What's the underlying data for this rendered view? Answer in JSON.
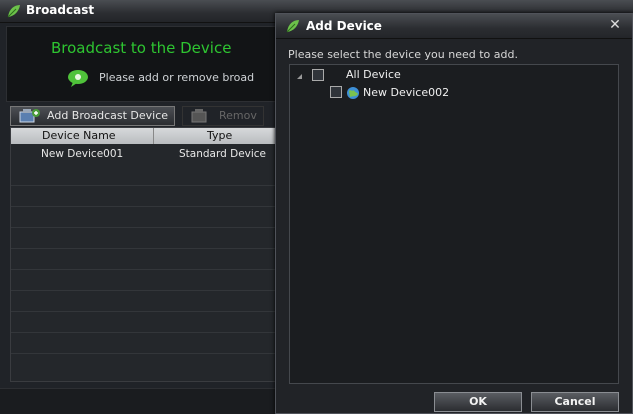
{
  "background_window": {
    "title": "Broadcast",
    "heading": "Broadcast to the Device",
    "hint": "Please add or remove broad",
    "toolbar": {
      "add_label": "Add Broadcast Device",
      "remove_label": "Remov"
    },
    "table": {
      "columns": [
        "Device Name",
        "Type"
      ],
      "rows": [
        {
          "name": "New Device001",
          "type": "Standard Device"
        }
      ]
    }
  },
  "dialog": {
    "title": "Add Device",
    "prompt": "Please select the device you need to add.",
    "tree": {
      "root": {
        "label": "All Device",
        "checked": false,
        "expanded": true
      },
      "children": [
        {
          "label": "New Device002",
          "checked": false,
          "icon": "device-globe-icon"
        }
      ]
    },
    "buttons": {
      "ok": "OK",
      "cancel": "Cancel"
    }
  },
  "colors": {
    "accent_green": "#2ec531",
    "background": "#202328",
    "panel": "#121416"
  }
}
